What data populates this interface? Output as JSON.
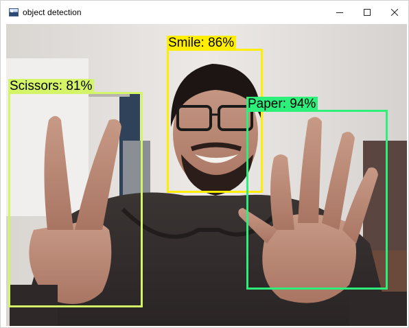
{
  "window": {
    "title": "object detection",
    "app_icon": "opencv-window-icon",
    "controls": [
      "minimize-icon",
      "maximize-icon",
      "close-icon"
    ]
  },
  "detections": [
    {
      "label": "Smile: 86%",
      "color": "#ffee00"
    },
    {
      "label": "Scissors: 81%",
      "color": "#d4f567"
    },
    {
      "label": "Paper: 94%",
      "color": "#2cf07a"
    }
  ]
}
